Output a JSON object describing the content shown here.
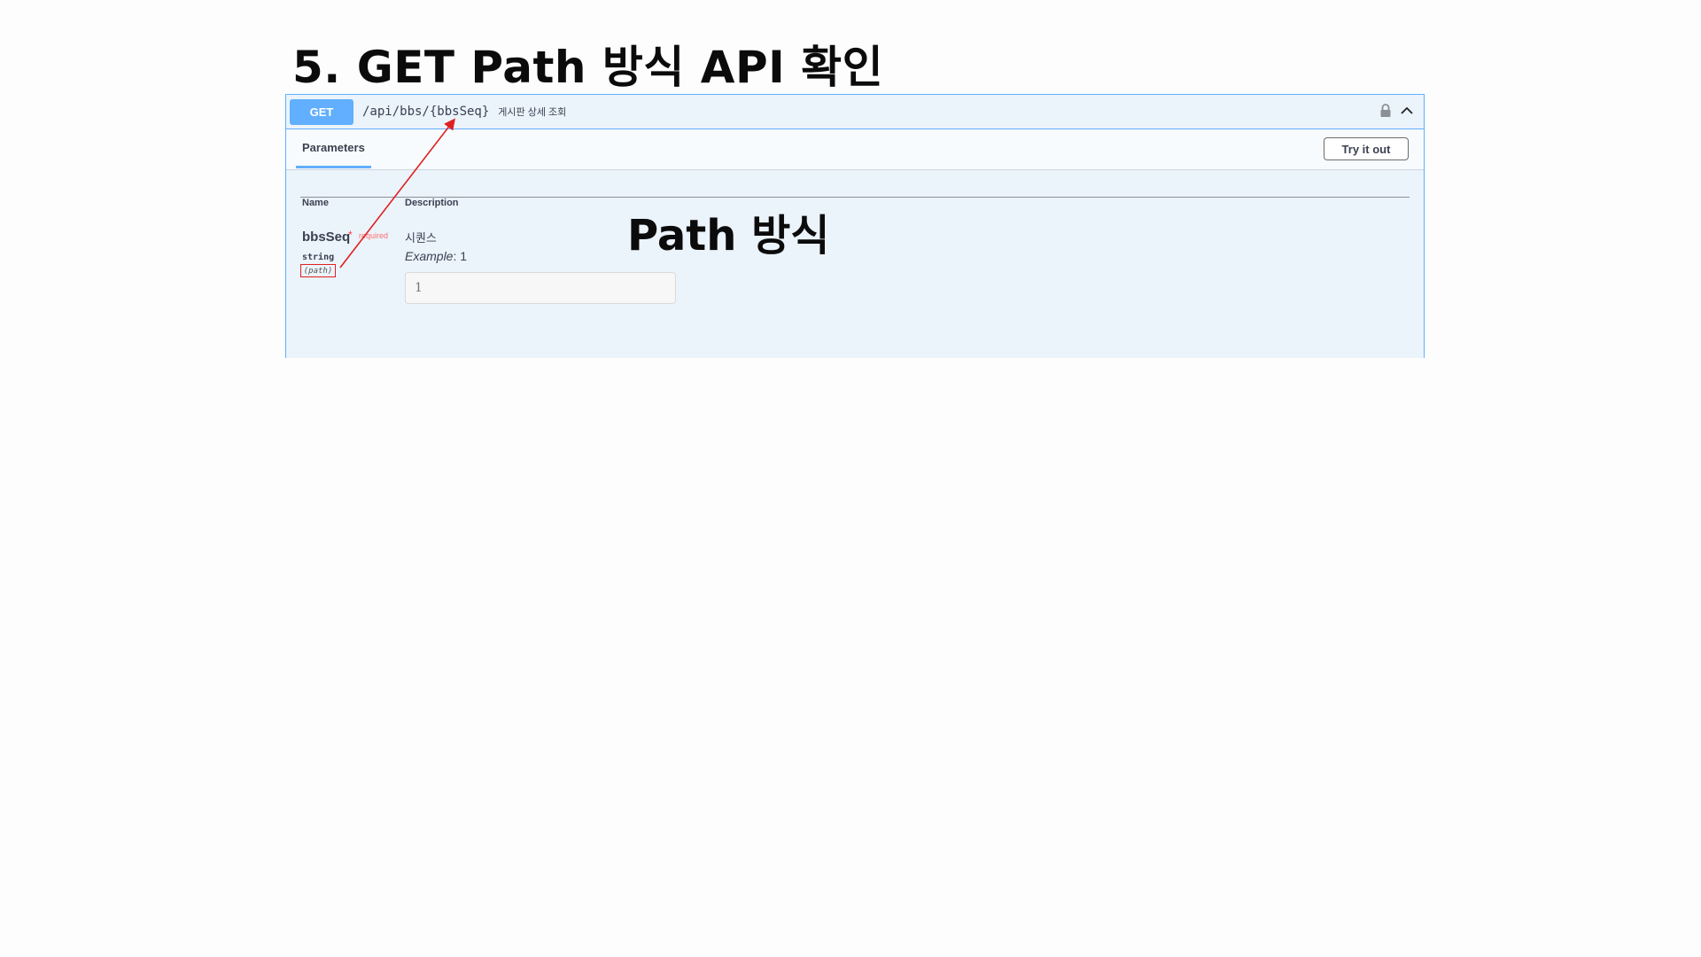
{
  "slide": {
    "title": "5. GET Path 방식 API 확인",
    "annotation": "Path 방식"
  },
  "opblock": {
    "method": "GET",
    "path": "/api/bbs/{bbsSeq}",
    "summary": "게시판 상세 조회",
    "lock_icon": "lock-icon",
    "collapse_icon": "chevron-up-icon",
    "accent_color": "#61affe",
    "tabs": {
      "parameters": "Parameters"
    },
    "try_button": "Try it out",
    "columns": {
      "name": "Name",
      "description": "Description"
    },
    "params": [
      {
        "name": "bbsSeq",
        "required_star": "*",
        "required_label": "required",
        "type": "string",
        "in": "(path)",
        "description": "시퀀스",
        "example_label": "Example",
        "example_value": ": 1",
        "input_placeholder": "1"
      }
    ]
  },
  "colors": {
    "highlight": "#e02020"
  }
}
